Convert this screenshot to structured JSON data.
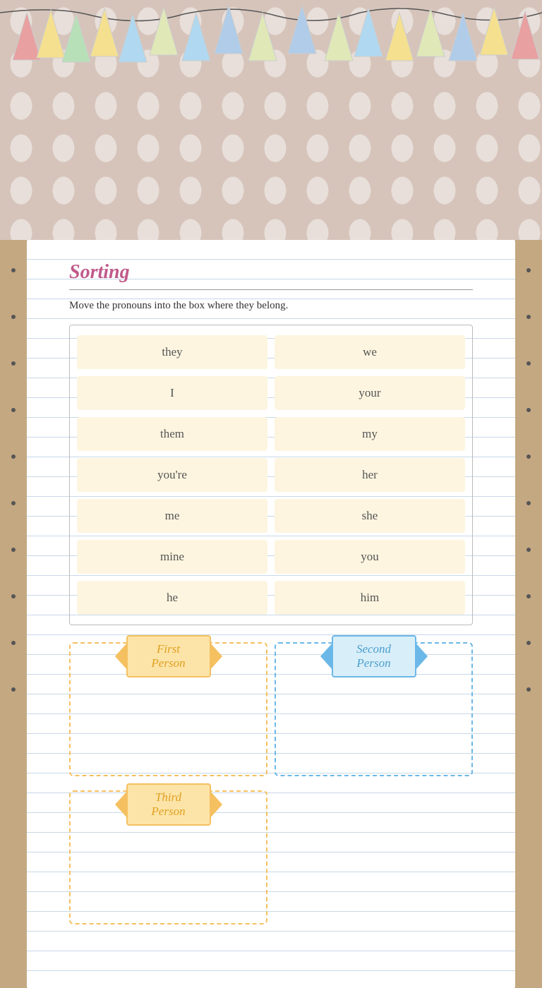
{
  "title": "Sorting",
  "instructions": "Move the pronouns into the box where they belong.",
  "words": [
    {
      "id": "w1",
      "text": "they"
    },
    {
      "id": "w2",
      "text": "we"
    },
    {
      "id": "w3",
      "text": "I"
    },
    {
      "id": "w4",
      "text": "your"
    },
    {
      "id": "w5",
      "text": "them"
    },
    {
      "id": "w6",
      "text": "my"
    },
    {
      "id": "w7",
      "text": "you're"
    },
    {
      "id": "w8",
      "text": "her"
    },
    {
      "id": "w9",
      "text": "me"
    },
    {
      "id": "w10",
      "text": "she"
    },
    {
      "id": "w11",
      "text": "mine"
    },
    {
      "id": "w12",
      "text": "you"
    },
    {
      "id": "w13",
      "text": "he"
    },
    {
      "id": "w14",
      "text": "him"
    }
  ],
  "categories": {
    "first": "First Person",
    "second": "Second Person",
    "third": "Third Person"
  },
  "colors": {
    "background_top": "#d6c4bb",
    "card_bg": "#ffffff",
    "accent_pink": "#c05a8a",
    "word_chip_bg": "#fdf5e0",
    "ribbon_orange": "#f5c060",
    "ribbon_blue": "#6bb8e8",
    "dashed_orange": "#f5c060",
    "dashed_blue": "#6bb8e8"
  }
}
